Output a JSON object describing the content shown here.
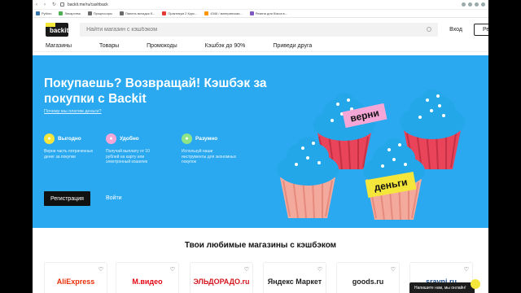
{
  "browser": {
    "url": "backit.me/ru/cashback",
    "bookmarks": [
      {
        "label": "Python",
        "color": "#3776ab"
      },
      {
        "label": "Лекарства",
        "color": "#4caf50"
      },
      {
        "label": "Процессоры",
        "color": "#6b6b6b"
      },
      {
        "label": "Панель вкладок б...",
        "color": "#6b6b6b"
      },
      {
        "label": "Практикум 2 Курс...",
        "color": "#e53935"
      },
      {
        "label": "4346 / материнская...",
        "color": "#ff9800"
      },
      {
        "label": "Резина для бокса в...",
        "color": "#7e57c2"
      }
    ]
  },
  "header": {
    "logo": "backit",
    "search_placeholder": "Найти магазин с кэшбэком",
    "login": "Вход",
    "register": "Регистрация"
  },
  "nav": [
    "Магазины",
    "Товары",
    "Промокоды",
    "Кэшбэк до 90%",
    "Приведи друга"
  ],
  "hero": {
    "title": "Покупаешь? Возвращай! Кэшбэк за покупки с Backit",
    "why_link": "Почему мы платим деньги?",
    "features": [
      {
        "title": "Выгодно",
        "text": "Верни часть потраченных денег за покупки",
        "color": "#f5e63c",
        "icon": "coins-icon"
      },
      {
        "title": "Удобно",
        "text": "Получай выплату от 10 рублей на карту или электронный кошелек",
        "color": "#f4a6d7",
        "icon": "thumbs-up-icon"
      },
      {
        "title": "Разумно",
        "text": "Используй наши инструменты для экономных покупок",
        "color": "#8fe388",
        "icon": "chart-icon"
      }
    ],
    "register": "Регистрация",
    "login": "Войти",
    "sign_top": "верни",
    "sign_bottom": "деньги"
  },
  "stores": {
    "title": "Твои любимые магазины с кэшбэком",
    "items": [
      {
        "name": "AliExpress",
        "color": "#e62e04"
      },
      {
        "name": "М.видео",
        "color": "#e30613"
      },
      {
        "name": "ЭЛЬДОРАДО.ru",
        "color": "#d4171e"
      },
      {
        "name": "Яндекс Маркет",
        "color": "#222222"
      },
      {
        "name": "goods.ru",
        "color": "#222222"
      },
      {
        "name": "sravni.ru",
        "color": "#1a4a8a"
      }
    ]
  },
  "chat": "Напишите нам, мы онлайн!"
}
